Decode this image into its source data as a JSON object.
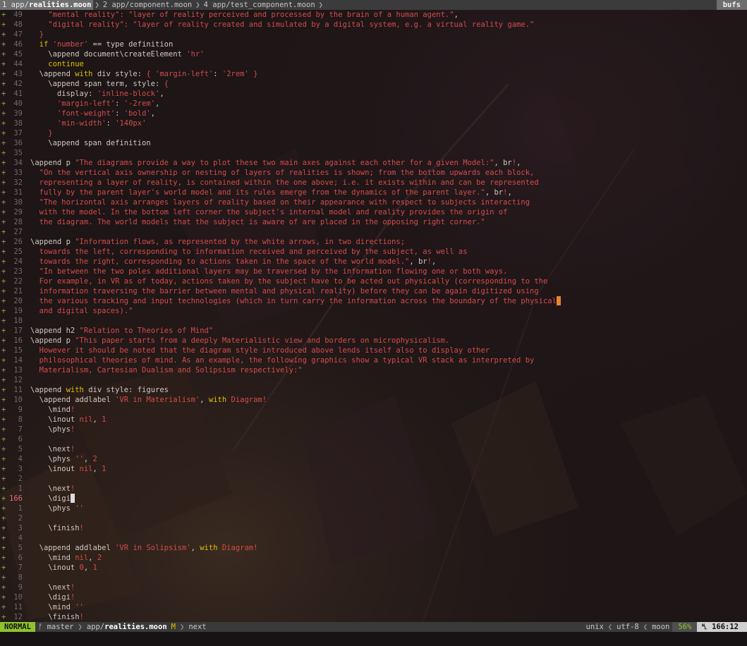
{
  "tabs": [
    {
      "num": "1",
      "dir": "app/",
      "file": "realities.moon",
      "active": true
    },
    {
      "num": "2",
      "dir": "app/",
      "file": "component.moon",
      "active": false
    },
    {
      "num": "4",
      "dir": "app/",
      "file": "test_component.moon",
      "active": false
    }
  ],
  "bufs_label": "bufs",
  "lines": [
    {
      "sign": "+",
      "num": "49",
      "segs": [
        [
          "t",
          "    "
        ],
        [
          "s",
          "\"mental reality\": \"layer of reality perceived and processed by the brain of a human agent.\""
        ],
        [
          "t",
          ","
        ]
      ]
    },
    {
      "sign": "+",
      "num": "48",
      "segs": [
        [
          "t",
          "    "
        ],
        [
          "s",
          "\"digital reality\": \"layer of reality created and simulated by a digital system, e.g. a virtual reality game.\""
        ]
      ]
    },
    {
      "sign": "+",
      "num": "47",
      "segs": [
        [
          "t",
          "  "
        ],
        [
          "p",
          "}"
        ]
      ]
    },
    {
      "sign": "+",
      "num": "46",
      "segs": [
        [
          "t",
          "  "
        ],
        [
          "k",
          "if"
        ],
        [
          "t",
          " "
        ],
        [
          "s",
          "'number'"
        ],
        [
          "t",
          " == type definition"
        ]
      ]
    },
    {
      "sign": "+",
      "num": "45",
      "segs": [
        [
          "t",
          "    \\append document\\createElement "
        ],
        [
          "s",
          "'hr'"
        ]
      ]
    },
    {
      "sign": "+",
      "num": "44",
      "segs": [
        [
          "t",
          "    "
        ],
        [
          "k",
          "continue"
        ]
      ]
    },
    {
      "sign": "+",
      "num": "43",
      "segs": [
        [
          "t",
          "  \\append "
        ],
        [
          "k",
          "with"
        ],
        [
          "t",
          " div style: "
        ],
        [
          "p",
          "{"
        ],
        [
          "t",
          " "
        ],
        [
          "s",
          "'margin-left'"
        ],
        [
          "t",
          ": "
        ],
        [
          "s",
          "'2rem'"
        ],
        [
          "t",
          " "
        ],
        [
          "p",
          "}"
        ]
      ]
    },
    {
      "sign": "+",
      "num": "42",
      "segs": [
        [
          "t",
          "    \\append span term, style: "
        ],
        [
          "p",
          "{"
        ]
      ]
    },
    {
      "sign": "+",
      "num": "41",
      "segs": [
        [
          "t",
          "      display: "
        ],
        [
          "s",
          "'inline-block'"
        ],
        [
          "t",
          ","
        ]
      ]
    },
    {
      "sign": "+",
      "num": "40",
      "segs": [
        [
          "t",
          "      "
        ],
        [
          "s",
          "'margin-left'"
        ],
        [
          "t",
          ": "
        ],
        [
          "s",
          "'-2rem'"
        ],
        [
          "t",
          ","
        ]
      ]
    },
    {
      "sign": "+",
      "num": "39",
      "segs": [
        [
          "t",
          "      "
        ],
        [
          "s",
          "'font-weight'"
        ],
        [
          "t",
          ": "
        ],
        [
          "s",
          "'bold'"
        ],
        [
          "t",
          ","
        ]
      ]
    },
    {
      "sign": "+",
      "num": "38",
      "segs": [
        [
          "t",
          "      "
        ],
        [
          "s",
          "'min-width'"
        ],
        [
          "t",
          ": "
        ],
        [
          "s",
          "'140px'"
        ]
      ]
    },
    {
      "sign": "+",
      "num": "37",
      "segs": [
        [
          "t",
          "    "
        ],
        [
          "p",
          "}"
        ]
      ]
    },
    {
      "sign": "+",
      "num": "36",
      "segs": [
        [
          "t",
          "    \\append span definition"
        ]
      ]
    },
    {
      "sign": "+",
      "num": "35",
      "segs": []
    },
    {
      "sign": "+",
      "num": "34",
      "segs": [
        [
          "t",
          "\\append p "
        ],
        [
          "s",
          "\"The diagrams provide a way to plot these two main axes against each other for a given Model:\""
        ],
        [
          "t",
          ", br"
        ],
        [
          "p",
          "!"
        ],
        [
          "t",
          ","
        ]
      ]
    },
    {
      "sign": "+",
      "num": "33",
      "segs": [
        [
          "t",
          "  "
        ],
        [
          "s",
          "\"On the vertical axis ownership or nesting of layers of realities is shown; from the bottom upwards each block,"
        ]
      ]
    },
    {
      "sign": "+",
      "num": "32",
      "segs": [
        [
          "t",
          "  "
        ],
        [
          "s",
          "representing a layer of reality, is contained within the one above; i.e. it exists within and can be represented"
        ]
      ]
    },
    {
      "sign": "+",
      "num": "31",
      "segs": [
        [
          "t",
          "  "
        ],
        [
          "s",
          "fully by the parent layer's world model and its rules emerge from the dynamics of the parent layer.\""
        ],
        [
          "t",
          ", br"
        ],
        [
          "p",
          "!"
        ],
        [
          "t",
          ","
        ]
      ]
    },
    {
      "sign": "+",
      "num": "30",
      "segs": [
        [
          "t",
          "  "
        ],
        [
          "s",
          "\"The horizontal axis arranges layers of reality based on their appearance with respect to subjects interacting"
        ]
      ]
    },
    {
      "sign": "+",
      "num": "29",
      "segs": [
        [
          "t",
          "  "
        ],
        [
          "s",
          "with the model. In the bottom left corner the subject's internal model and reality provides the origin of"
        ]
      ]
    },
    {
      "sign": "+",
      "num": "28",
      "segs": [
        [
          "t",
          "  "
        ],
        [
          "s",
          "the diagram. The world models that the subject is aware of are placed in the opposing right corner.\""
        ]
      ]
    },
    {
      "sign": "+",
      "num": "27",
      "segs": []
    },
    {
      "sign": "+",
      "num": "26",
      "segs": [
        [
          "t",
          "\\append p "
        ],
        [
          "s",
          "\"Information flows, as represented by the white arrows, in two directions;"
        ]
      ]
    },
    {
      "sign": "+",
      "num": "25",
      "segs": [
        [
          "t",
          "  "
        ],
        [
          "s",
          "towards the left, corresponding to information received and perceived by the subject, as well as"
        ]
      ]
    },
    {
      "sign": "+",
      "num": "24",
      "segs": [
        [
          "t",
          "  "
        ],
        [
          "s",
          "towards the right, corresponding to actions taken in the space of the world model.\""
        ],
        [
          "t",
          ", br"
        ],
        [
          "p",
          "!"
        ],
        [
          "t",
          ","
        ]
      ]
    },
    {
      "sign": "+",
      "num": "23",
      "segs": [
        [
          "t",
          "  "
        ],
        [
          "s",
          "\"In between the two poles additional layers may be traversed by the information flowing one or both ways."
        ]
      ]
    },
    {
      "sign": "+",
      "num": "22",
      "segs": [
        [
          "t",
          "  "
        ],
        [
          "s",
          "For example, in VR as of today, actions taken by the subject have to be acted out physically (corresponding to the"
        ]
      ]
    },
    {
      "sign": "+",
      "num": "21",
      "segs": [
        [
          "t",
          "  "
        ],
        [
          "s",
          "information traversing the barrier between mental and physical reality) before they can be again digitized using"
        ]
      ]
    },
    {
      "sign": "+",
      "num": "20",
      "segs": [
        [
          "t",
          "  "
        ],
        [
          "s",
          "the various tracking and input technologies (which in turn carry the information across the boundary of the physical"
        ],
        [
          "ct",
          ""
        ]
      ]
    },
    {
      "sign": "+",
      "num": "19",
      "segs": [
        [
          "t",
          "  "
        ],
        [
          "s",
          "and digital spaces).\""
        ]
      ]
    },
    {
      "sign": "+",
      "num": "18",
      "segs": []
    },
    {
      "sign": "+",
      "num": "17",
      "segs": [
        [
          "t",
          "\\append h2 "
        ],
        [
          "s",
          "\"Relation to Theories of Mind\""
        ]
      ]
    },
    {
      "sign": "+",
      "num": "16",
      "segs": [
        [
          "t",
          "\\append p "
        ],
        [
          "s",
          "\"This paper starts from a deeply Materialistic view and borders on microphysicalism."
        ]
      ]
    },
    {
      "sign": "+",
      "num": "15",
      "segs": [
        [
          "t",
          "  "
        ],
        [
          "s",
          "However it should be noted that the diagram style introduced above lends itself also to display other"
        ]
      ]
    },
    {
      "sign": "+",
      "num": "14",
      "segs": [
        [
          "t",
          "  "
        ],
        [
          "s",
          "philosophical theories of mind. As an example, the following graphics show a typical VR stack as interpreted by"
        ]
      ]
    },
    {
      "sign": "+",
      "num": "13",
      "segs": [
        [
          "t",
          "  "
        ],
        [
          "s",
          "Materialism, Cartesian Dualism and Solipsism respectively:\""
        ]
      ]
    },
    {
      "sign": "+",
      "num": "12",
      "segs": []
    },
    {
      "sign": "+",
      "num": "11",
      "segs": [
        [
          "t",
          "\\append "
        ],
        [
          "k",
          "with"
        ],
        [
          "t",
          " div style: figures"
        ]
      ]
    },
    {
      "sign": "+",
      "num": "10",
      "segs": [
        [
          "t",
          "  \\append addlabel "
        ],
        [
          "s",
          "'VR in Materialism'"
        ],
        [
          "t",
          ", "
        ],
        [
          "k",
          "with"
        ],
        [
          "t",
          " "
        ],
        [
          "s",
          "Diagram"
        ],
        [
          "p",
          "!"
        ]
      ]
    },
    {
      "sign": "+",
      "num": "9",
      "segs": [
        [
          "t",
          "    \\mind"
        ],
        [
          "p",
          "!"
        ]
      ]
    },
    {
      "sign": "+",
      "num": "8",
      "segs": [
        [
          "t",
          "    \\inout "
        ],
        [
          "n",
          "nil"
        ],
        [
          "t",
          ", "
        ],
        [
          "n",
          "1"
        ]
      ]
    },
    {
      "sign": "+",
      "num": "7",
      "segs": [
        [
          "t",
          "    \\phys"
        ],
        [
          "p",
          "!"
        ]
      ]
    },
    {
      "sign": "+",
      "num": "6",
      "segs": []
    },
    {
      "sign": "+",
      "num": "5",
      "segs": [
        [
          "t",
          "    \\next"
        ],
        [
          "p",
          "!"
        ]
      ]
    },
    {
      "sign": "+",
      "num": "4",
      "segs": [
        [
          "t",
          "    \\phys "
        ],
        [
          "s",
          "''"
        ],
        [
          "t",
          ", "
        ],
        [
          "n",
          "2"
        ]
      ]
    },
    {
      "sign": "+",
      "num": "3",
      "segs": [
        [
          "t",
          "    \\inout "
        ],
        [
          "n",
          "nil"
        ],
        [
          "t",
          ", "
        ],
        [
          "n",
          "1"
        ]
      ]
    },
    {
      "sign": "+",
      "num": "2",
      "segs": []
    },
    {
      "sign": "+",
      "num": "1",
      "segs": [
        [
          "t",
          "    \\next"
        ],
        [
          "p",
          "!"
        ]
      ]
    },
    {
      "sign": "+",
      "num": "166",
      "current": true,
      "segs": [
        [
          "t",
          "    \\digi"
        ],
        [
          "cb",
          ""
        ]
      ]
    },
    {
      "sign": "+",
      "num": "1",
      "segs": [
        [
          "t",
          "    \\phys "
        ],
        [
          "s",
          "''"
        ]
      ]
    },
    {
      "sign": "+",
      "num": "2",
      "segs": []
    },
    {
      "sign": "+",
      "num": "3",
      "segs": [
        [
          "t",
          "    \\finish"
        ],
        [
          "p",
          "!"
        ]
      ]
    },
    {
      "sign": "+",
      "num": "4",
      "segs": []
    },
    {
      "sign": "+",
      "num": "5",
      "segs": [
        [
          "t",
          "  \\append addlabel "
        ],
        [
          "s",
          "'VR in Solipsism'"
        ],
        [
          "t",
          ", "
        ],
        [
          "k",
          "with"
        ],
        [
          "t",
          " "
        ],
        [
          "s",
          "Diagram"
        ],
        [
          "p",
          "!"
        ]
      ]
    },
    {
      "sign": "+",
      "num": "6",
      "segs": [
        [
          "t",
          "    \\mind "
        ],
        [
          "n",
          "nil"
        ],
        [
          "t",
          ", "
        ],
        [
          "n",
          "2"
        ]
      ]
    },
    {
      "sign": "+",
      "num": "7",
      "segs": [
        [
          "t",
          "    \\inout "
        ],
        [
          "n",
          "0"
        ],
        [
          "t",
          ", "
        ],
        [
          "n",
          "1"
        ]
      ]
    },
    {
      "sign": "+",
      "num": "8",
      "segs": []
    },
    {
      "sign": "+",
      "num": "9",
      "segs": [
        [
          "t",
          "    \\next"
        ],
        [
          "p",
          "!"
        ]
      ]
    },
    {
      "sign": "+",
      "num": "10",
      "segs": [
        [
          "t",
          "    \\digi"
        ],
        [
          "p",
          "!"
        ]
      ]
    },
    {
      "sign": "+",
      "num": "11",
      "segs": [
        [
          "t",
          "    \\mind "
        ],
        [
          "s",
          "''"
        ]
      ]
    },
    {
      "sign": "+",
      "num": "12",
      "segs": [
        [
          "t",
          "    \\finish"
        ],
        [
          "p",
          "!"
        ]
      ]
    }
  ],
  "status": {
    "mode": "NORMAL",
    "branch_icon": "ᚠ",
    "branch": "master",
    "dir": "app/",
    "file": "realities.moon",
    "modified": "M",
    "func": "next",
    "fileformat": "unix",
    "encoding": "utf-8",
    "filetype": "moon",
    "percent": "56%",
    "line_icon": "␤",
    "position": "166:12"
  },
  "colors": {
    "string": "#d24c4c",
    "keyword": "#e0c000",
    "mode_bg": "#8ec32e",
    "cursor": "#e8852c"
  }
}
